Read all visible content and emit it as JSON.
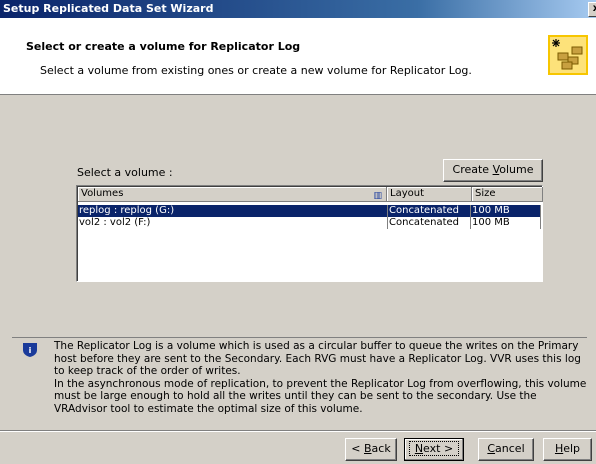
{
  "window": {
    "title": "Setup Replicated Data Set Wizard",
    "close_label": "x"
  },
  "header": {
    "title": "Select or create a volume for Replicator Log",
    "subtitle": "Select a volume from existing ones or create a new volume for Replicator Log."
  },
  "select_label": "Select a volume :",
  "create_button": {
    "prefix": "Create ",
    "access": "V",
    "rest": "olume"
  },
  "volumes_table": {
    "columns": [
      "Volumes",
      "Layout",
      "Size"
    ],
    "rows": [
      {
        "volume": "replog : replog (G:)",
        "layout": "Concatenated",
        "size": "100 MB",
        "selected": true
      },
      {
        "volume": "vol2 : vol2 (F:)",
        "layout": "Concatenated",
        "size": "100 MB",
        "selected": false
      }
    ]
  },
  "info": {
    "paragraph1": "The Replicator Log is a volume which is used as a circular buffer to queue the writes on the Primary host before they are sent to the Secondary. Each RVG must have a Replicator Log. VVR uses this log to keep track of the order of writes.",
    "paragraph2": "In the asynchronous mode of replication, to prevent the Replicator Log from overflowing, this volume must be large enough to hold all the writes until they can be sent to the secondary. Use the VRAdvisor tool to estimate the optimal size of this volume."
  },
  "footer": {
    "back": {
      "prefix": "< ",
      "access": "B",
      "rest": "ack"
    },
    "next": {
      "prefix": "",
      "access": "N",
      "rest": "ext >"
    },
    "cancel": {
      "prefix": "",
      "access": "C",
      "rest": "ancel"
    },
    "help": {
      "prefix": "",
      "access": "H",
      "rest": "elp"
    }
  },
  "colors": {
    "title_bar": "#0a246a",
    "selection": "#0a246a",
    "dialog_bg": "#d4d0c8"
  }
}
